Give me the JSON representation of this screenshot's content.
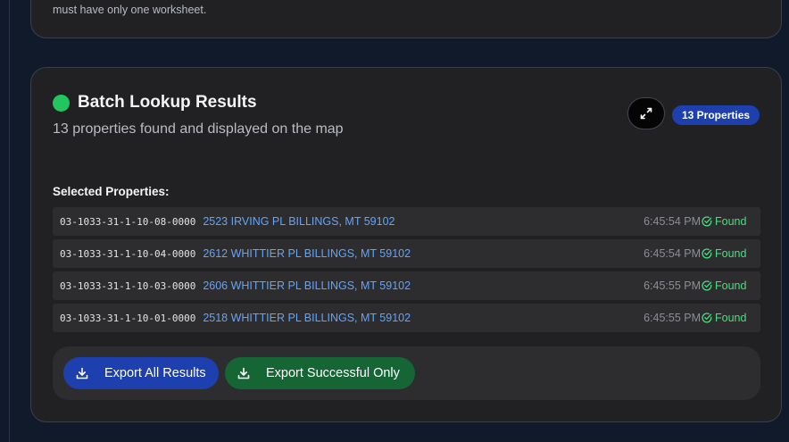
{
  "top_card": {
    "note": "must have only one worksheet."
  },
  "results": {
    "title": "Batch Lookup Results",
    "subtitle": "13 properties found and displayed on the map",
    "badge": "13 Properties",
    "section_label": "Selected Properties:",
    "rows": [
      {
        "parcel": "03-1033-31-1-10-08-0000",
        "address": "2523 IRVING PL BILLINGS, MT 59102",
        "time": "6:45:54 PM",
        "status": "Found"
      },
      {
        "parcel": "03-1033-31-1-10-04-0000",
        "address": "2612 WHITTIER PL BILLINGS, MT 59102",
        "time": "6:45:54 PM",
        "status": "Found"
      },
      {
        "parcel": "03-1033-31-1-10-03-0000",
        "address": "2606 WHITTIER PL BILLINGS, MT 59102",
        "time": "6:45:55 PM",
        "status": "Found"
      },
      {
        "parcel": "03-1033-31-1-10-01-0000",
        "address": "2518 WHITTIER PL BILLINGS, MT 59102",
        "time": "6:45:55 PM",
        "status": "Found"
      }
    ],
    "export_all_label": "Export All Results",
    "export_success_label": "Export Successful Only"
  },
  "icons": {
    "status": "green-dot-icon",
    "expand": "expand-arrows-icon",
    "found": "check-circle-icon",
    "download": "download-icon"
  },
  "colors": {
    "success": "#22c55e",
    "primary": "#1e40af",
    "secondary_action": "#166534",
    "link": "#60a5fa"
  }
}
